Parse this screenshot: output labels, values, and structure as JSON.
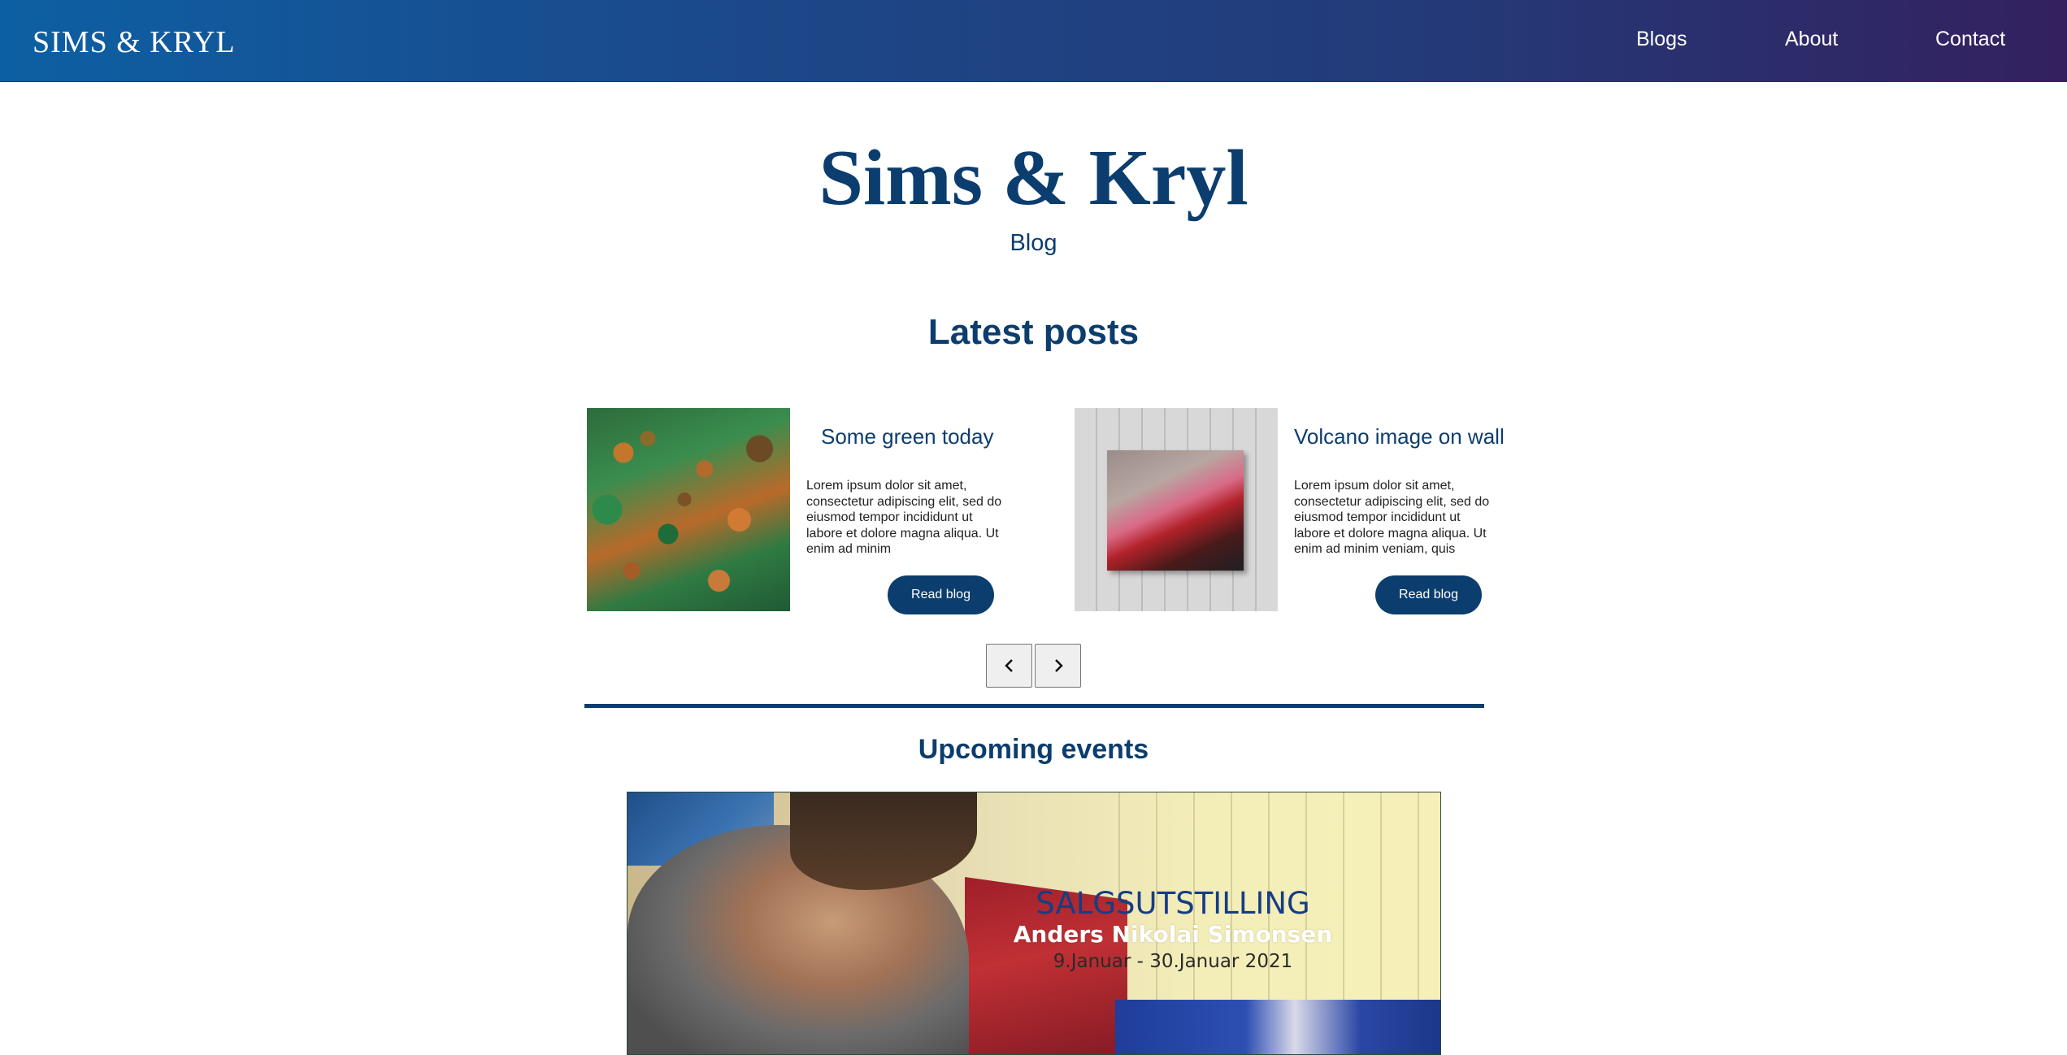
{
  "navbar": {
    "brand": "SIMS & KRYL",
    "links": [
      "Blogs",
      "About",
      "Contact"
    ],
    "gradient_start": "#0d5fa3",
    "gradient_end": "#34205f"
  },
  "hero": {
    "title": "Sims & Kryl",
    "subtitle": "Blog"
  },
  "latest_posts": {
    "heading": "Latest posts",
    "posts": [
      {
        "title": "Some green today",
        "excerpt": "Lorem ipsum dolor sit amet, consectetur adipiscing elit, sed do eiusmod tempor incididunt ut labore et dolore magna aliqua. Ut enim ad minim",
        "button_label": "Read blog",
        "image": "green-abstract-painting"
      },
      {
        "title": "Volcano image on wall",
        "excerpt": "Lorem ipsum dolor sit amet, consectetur adipiscing elit, sed do eiusmod tempor incididunt ut labore et dolore magna aliqua. Ut enim ad minim veniam, quis",
        "button_label": "Read blog",
        "image": "volcano-painting-on-wall"
      }
    ],
    "carousel": {
      "prev_icon": "chevron-left-icon",
      "next_icon": "chevron-right-icon"
    }
  },
  "upcoming_events": {
    "heading": "Upcoming events",
    "banner": {
      "line1": "SALGSUTSTILLING",
      "line2": "Anders Nikolai Simonsen",
      "line3": "9.Januar  -  30.Januar 2021"
    }
  },
  "colors": {
    "primary": "#0b3d6e",
    "text": "#222222",
    "background": "#ffffff"
  }
}
